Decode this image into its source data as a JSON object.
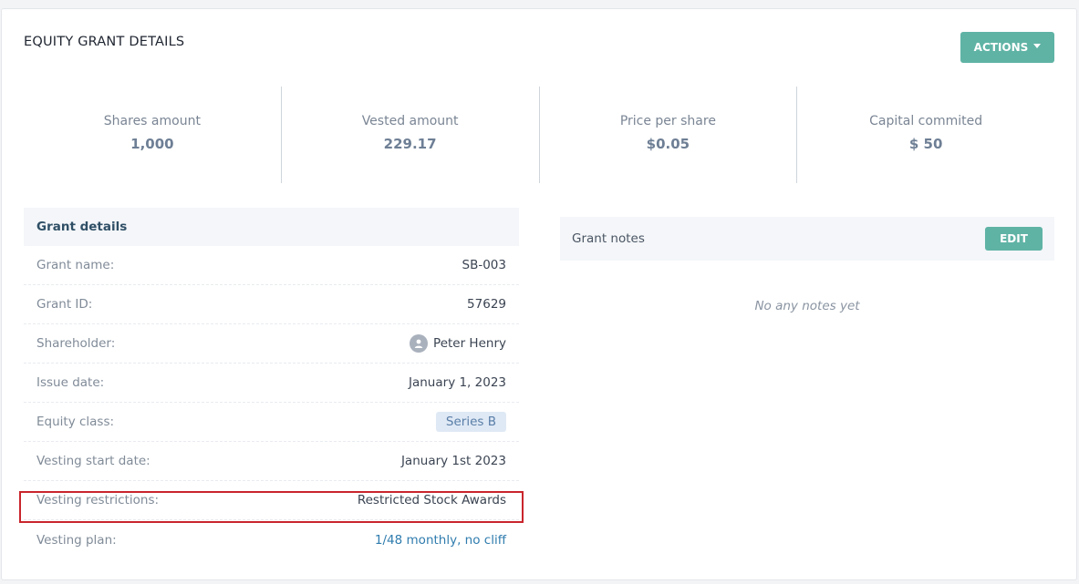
{
  "header": {
    "title": "EQUITY GRANT DETAILS",
    "actions_label": "ACTIONS"
  },
  "stats": [
    {
      "label": "Shares amount",
      "value": "1,000"
    },
    {
      "label": "Vested amount",
      "value": "229.17"
    },
    {
      "label": "Price per share",
      "value": "$0.05"
    },
    {
      "label": "Capital commited",
      "value": "$ 50"
    }
  ],
  "grant_details": {
    "title": "Grant details",
    "rows": [
      {
        "label": "Grant name:",
        "value": "SB-003"
      },
      {
        "label": "Grant ID:",
        "value": "57629"
      },
      {
        "label": "Shareholder:",
        "value": "Peter Henry"
      },
      {
        "label": "Issue date:",
        "value": "January 1, 2023"
      },
      {
        "label": "Equity class:",
        "value": "Series B"
      },
      {
        "label": "Vesting start date:",
        "value": "January 1st 2023"
      },
      {
        "label": "Vesting restrictions:",
        "value": "Restricted Stock Awards"
      },
      {
        "label": "Vesting plan:",
        "value": "1/48 monthly, no cliff"
      }
    ]
  },
  "grant_notes": {
    "title": "Grant notes",
    "edit_label": "EDIT",
    "empty_text": "No any notes yet"
  },
  "colors": {
    "accent": "#5fb3a5",
    "link": "#2f7cae",
    "highlight": "#c9252c"
  }
}
